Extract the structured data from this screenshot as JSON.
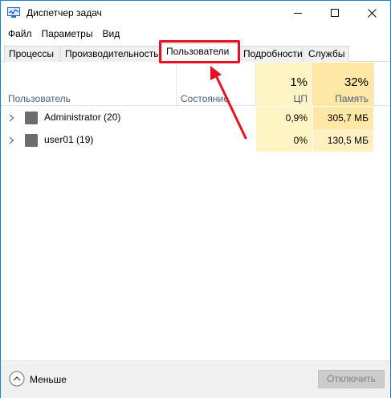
{
  "window": {
    "title": "Диспетчер задач",
    "icon": "task-manager-icon"
  },
  "menu": {
    "items": [
      "Файл",
      "Параметры",
      "Вид"
    ]
  },
  "tabs": [
    {
      "label": "Процессы",
      "active": false
    },
    {
      "label": "Производительность",
      "active": false
    },
    {
      "label": "Пользователи",
      "active": true
    },
    {
      "label": "Подробности",
      "active": false
    },
    {
      "label": "Службы",
      "active": false
    }
  ],
  "header": {
    "user_label": "Пользователь",
    "status_label": "Состояние",
    "cpu_pct": "1%",
    "cpu_label": "ЦП",
    "mem_pct": "32%",
    "mem_label": "Память"
  },
  "rows": [
    {
      "name": "Administrator (20)",
      "cpu": "0,9%",
      "memory": "305,7 МБ"
    },
    {
      "name": "user01 (19)",
      "cpu": "0%",
      "memory": "130,5 МБ"
    }
  ],
  "footer": {
    "fewer_label": "Меньше",
    "disconnect_label": "Отключить"
  },
  "colors": {
    "accent_border": "#1883d7",
    "highlight_red": "#e81123",
    "cpu_cell": "#fff4c4",
    "mem_cell_1": "#ffe8a6",
    "mem_cell_2": "#fff0c2",
    "cpu_header": "#fff4c4",
    "mem_header": "#ffe8a6"
  }
}
